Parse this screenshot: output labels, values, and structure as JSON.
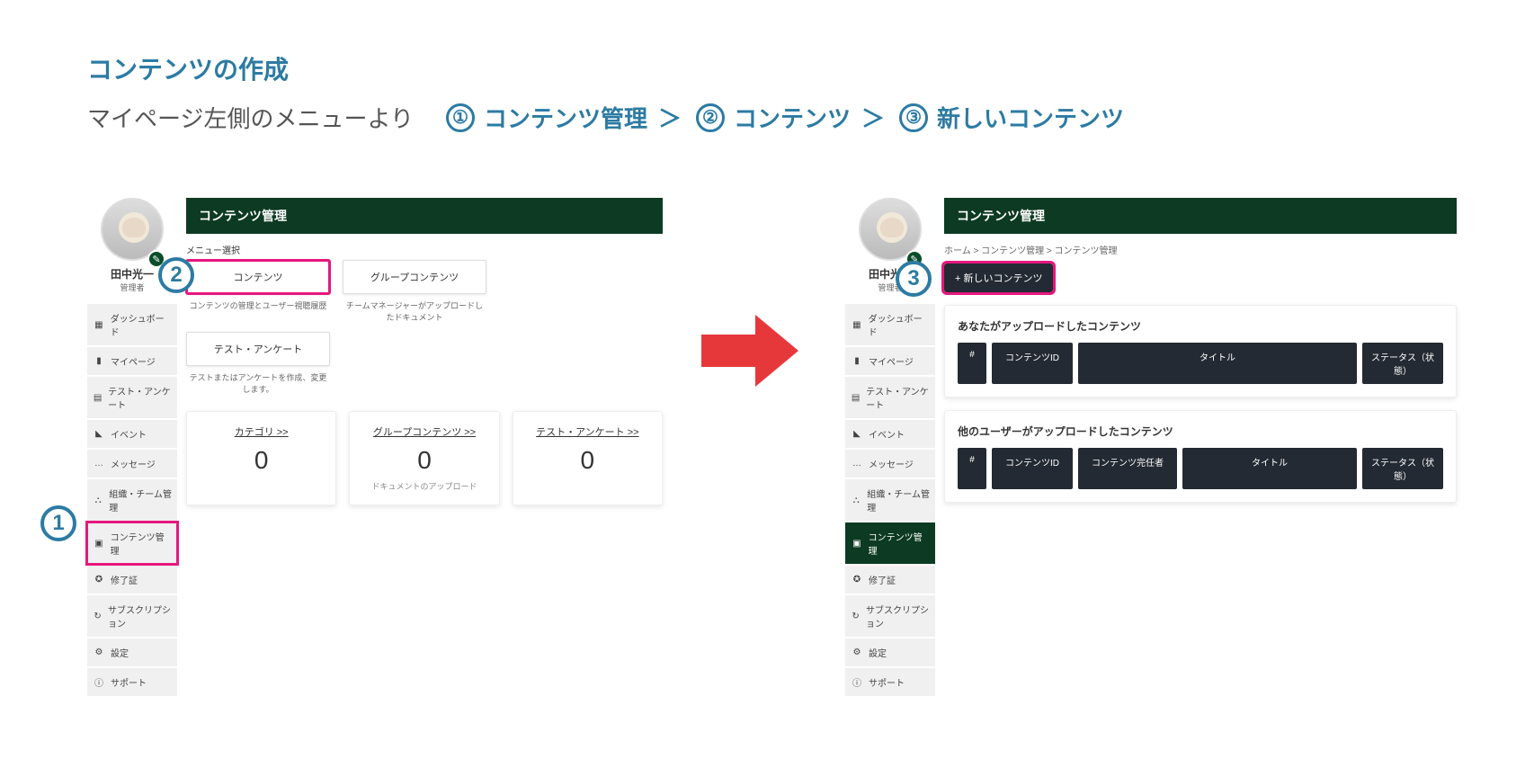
{
  "title": "コンテンツの作成",
  "instruction": {
    "prefix": "マイページ左側のメニューより",
    "steps": [
      "コンテンツ管理",
      "コンテンツ",
      "新しいコンテンツ"
    ]
  },
  "markers": {
    "one": "1",
    "two": "2",
    "three": "3"
  },
  "user": {
    "name": "田中光一",
    "role": "管理者"
  },
  "sidebar": {
    "items": [
      {
        "label": "ダッシュボード",
        "icon": "▦"
      },
      {
        "label": "マイページ",
        "icon": "▮"
      },
      {
        "label": "テスト・アンケート",
        "icon": "▤"
      },
      {
        "label": "イベント",
        "icon": "◣"
      },
      {
        "label": "メッセージ",
        "icon": "…"
      },
      {
        "label": "組織・チーム管理",
        "icon": "⛬"
      },
      {
        "label": "コンテンツ管理",
        "icon": "▣"
      },
      {
        "label": "修了証",
        "icon": "✪"
      },
      {
        "label": "サブスクリプション",
        "icon": "↻"
      },
      {
        "label": "設定",
        "icon": "⚙"
      },
      {
        "label": "サポート",
        "icon": "ⓘ"
      }
    ]
  },
  "left": {
    "header": "コンテンツ管理",
    "menu_label": "メニュー選択",
    "tabs": {
      "contents": "コンテンツ",
      "group": "グループコンテンツ",
      "test": "テスト・アンケート",
      "contents_desc": "コンテンツの管理とユーザー視聴履歴",
      "group_desc": "チームマネージャーがアップロードしたドキュメント",
      "test_desc": "テストまたはアンケートを作成、変更します。"
    },
    "stats": {
      "cat_title": "カテゴリ >>",
      "cat_val": "0",
      "grp_title": "グループコンテンツ >>",
      "grp_val": "0",
      "grp_sub": "ドキュメントのアップロード",
      "tst_title": "テスト・アンケート >>",
      "tst_val": "0"
    }
  },
  "right": {
    "header": "コンテンツ管理",
    "breadcrumb": "ホーム  >  コンテンツ管理  >  コンテンツ管理",
    "new_btn": "+ 新しいコンテンツ",
    "sec1": {
      "title": "あなたがアップロードしたコンテンツ",
      "cols": [
        "#",
        "コンテンツID",
        "タイトル",
        "ステータス（状態）"
      ]
    },
    "sec2": {
      "title": "他のユーザーがアップロードしたコンテンツ",
      "cols": [
        "#",
        "コンテンツID",
        "コンテンツ完任者",
        "タイトル",
        "ステータス（状態）"
      ]
    }
  }
}
